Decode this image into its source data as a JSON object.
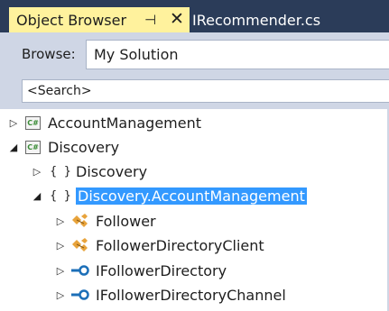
{
  "tabs": {
    "active_label": "Object Browser",
    "pin_glyph": "⊣",
    "close_glyph": "✕",
    "inactive_label": "IRecommender.cs"
  },
  "toolbar": {
    "browse_label": "Browse:",
    "browse_value": "My Solution",
    "search_placeholder": "<Search>"
  },
  "tree": {
    "rows": [
      {
        "label": "AccountManagement",
        "expander": "▷",
        "icon": "csharp-project-icon"
      },
      {
        "label": "Discovery",
        "expander": "◢",
        "icon": "csharp-project-icon"
      },
      {
        "label": "Discovery",
        "expander": "▷",
        "icon": "namespace-icon"
      },
      {
        "label": "Discovery.AccountManagement",
        "expander": "◢",
        "icon": "namespace-icon",
        "selected": true
      },
      {
        "label": "Follower",
        "expander": "▷",
        "icon": "class-icon"
      },
      {
        "label": "FollowerDirectoryClient",
        "expander": "▷",
        "icon": "class-icon"
      },
      {
        "label": "IFollowerDirectory",
        "expander": "▷",
        "icon": "interface-icon"
      },
      {
        "label": "IFollowerDirectoryChannel",
        "expander": "▷",
        "icon": "interface-icon"
      }
    ],
    "cs_text": "C#",
    "ns_text": "{ }"
  },
  "colors": {
    "tab_strip": "#2b3c59",
    "active_tab": "#fff29d",
    "toolbar_band": "#cfd6e5",
    "selection": "#3399ff",
    "class_icon": "#e8a33b",
    "interface_icon": "#1c6fb8"
  }
}
